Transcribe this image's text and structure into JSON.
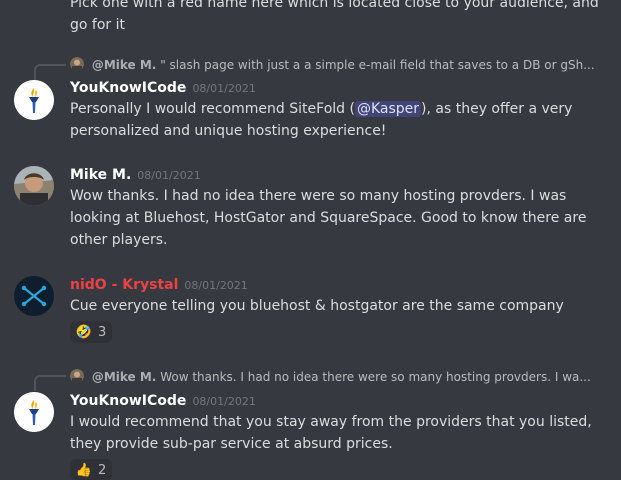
{
  "top": {
    "line1": "Pick one with a red name here which is located close to your audience, and",
    "line2": "go for it"
  },
  "messages": [
    {
      "reply": {
        "name": "@Mike M.",
        "text": "\" slash page with just a a simple e-mail field that saves to a DB or gSh..."
      },
      "author": "YouKnowICode",
      "author_color": "#ffffff",
      "time": "08/01/2021",
      "text_before": "Personally I would recommend SiteFold (",
      "mention": "@Kasper",
      "text_after": "), as they offer a very personalized and unique hosting experience!"
    },
    {
      "author": "Mike M.",
      "author_color": "#ffffff",
      "time": "08/01/2021",
      "text": "Wow thanks. I had no idea there were so many hosting provders. I was looking at Bluehost, HostGator and SquareSpace. Good to know there are other players."
    },
    {
      "author": "nidO - Krystal",
      "author_color": "#ed4245",
      "time": "08/01/2021",
      "text": "Cue everyone telling you bluehost & hostgator are the same company",
      "reaction": {
        "emoji": "🤣",
        "count": "3"
      }
    },
    {
      "reply": {
        "name": "@Mike M.",
        "text": "Wow thanks. I had no idea there were so many hosting provders. I wa..."
      },
      "author": "YouKnowICode",
      "author_color": "#ffffff",
      "time": "08/01/2021",
      "text": "I would recommend that you stay away from the providers that you listed, they provide sub-par service at absurd prices.",
      "reaction": {
        "emoji": "👍",
        "count": "2"
      }
    }
  ],
  "colors": {
    "background": "#36393f",
    "text": "#dcddde",
    "muted": "#72767d",
    "mention_bg": "#3c4270",
    "red_name": "#ed4245"
  }
}
